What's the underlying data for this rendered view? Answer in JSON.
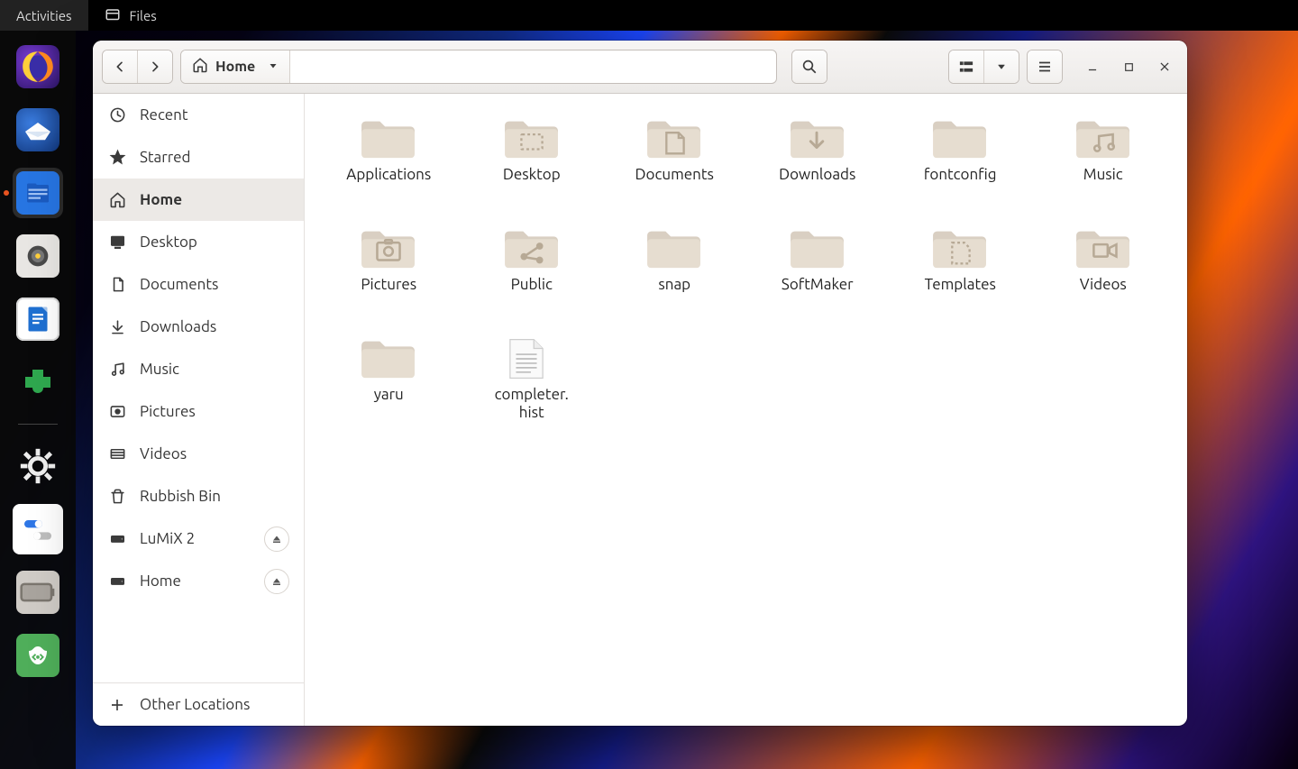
{
  "topbar": {
    "activities_label": "Activities",
    "app_label": "Files"
  },
  "dock": {
    "items": [
      "firefox",
      "thunderbird",
      "files",
      "rhythmbox",
      "libreoffice",
      "addons",
      "settings",
      "tweaks",
      "battery",
      "trash"
    ]
  },
  "window": {
    "path_label": "Home"
  },
  "sidebar": {
    "items": [
      {
        "icon": "recent",
        "label": "Recent"
      },
      {
        "icon": "star",
        "label": "Starred"
      },
      {
        "icon": "home",
        "label": "Home"
      },
      {
        "icon": "desktop",
        "label": "Desktop"
      },
      {
        "icon": "document",
        "label": "Documents"
      },
      {
        "icon": "download",
        "label": "Downloads"
      },
      {
        "icon": "music",
        "label": "Music"
      },
      {
        "icon": "picture",
        "label": "Pictures"
      },
      {
        "icon": "video",
        "label": "Videos"
      },
      {
        "icon": "trash",
        "label": "Rubbish Bin"
      },
      {
        "icon": "drive",
        "label": "LuMiX 2",
        "eject": true
      },
      {
        "icon": "drive",
        "label": "Home",
        "eject": true
      }
    ],
    "other_label": "Other Locations"
  },
  "files": [
    {
      "type": "folder",
      "variant": "plain",
      "label": "Applications"
    },
    {
      "type": "folder",
      "variant": "desktop",
      "label": "Desktop"
    },
    {
      "type": "folder",
      "variant": "documents",
      "label": "Documents"
    },
    {
      "type": "folder",
      "variant": "downloads",
      "label": "Downloads"
    },
    {
      "type": "folder",
      "variant": "plain",
      "label": "fontconfig"
    },
    {
      "type": "folder",
      "variant": "music",
      "label": "Music"
    },
    {
      "type": "folder",
      "variant": "pictures",
      "label": "Pictures"
    },
    {
      "type": "folder",
      "variant": "public",
      "label": "Public"
    },
    {
      "type": "folder",
      "variant": "plain",
      "label": "snap"
    },
    {
      "type": "folder",
      "variant": "plain",
      "label": "SoftMaker"
    },
    {
      "type": "folder",
      "variant": "templates",
      "label": "Templates"
    },
    {
      "type": "folder",
      "variant": "videos",
      "label": "Videos"
    },
    {
      "type": "folder",
      "variant": "plain",
      "label": "yaru"
    },
    {
      "type": "textfile",
      "variant": "",
      "label": "completer.\nhist"
    }
  ]
}
